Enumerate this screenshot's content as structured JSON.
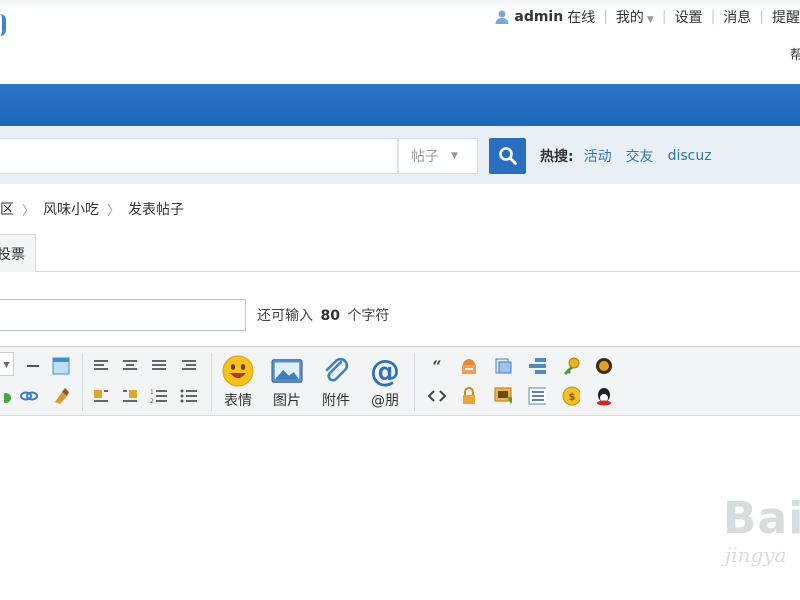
{
  "header": {
    "username": "admin",
    "online_status": "在线",
    "links": [
      "我的",
      "设置",
      "消息",
      "提醒"
    ],
    "right_fragment": "帮"
  },
  "search": {
    "scope": "帖子",
    "hot_label": "热搜:",
    "hot_links": [
      "活动",
      "交友",
      "discuz"
    ]
  },
  "breadcrumb": [
    "区",
    "风味小吃",
    "发表帖子"
  ],
  "tabs": {
    "active_label": "投票"
  },
  "subject": {
    "remaining_prefix": "还可输入",
    "remaining_count": "80",
    "remaining_suffix": "个字符"
  },
  "editor": {
    "buttons": [
      {
        "label": "表情",
        "icon": "smiley-icon"
      },
      {
        "label": "图片",
        "icon": "image-icon"
      },
      {
        "label": "附件",
        "icon": "paperclip-icon"
      },
      {
        "label": "@朋",
        "icon": "at-icon"
      }
    ]
  },
  "watermark": {
    "line1": "Bai",
    "line2": "jingya"
  },
  "colors": {
    "nav_blue": "#2270c2",
    "search_bg": "#e8eff5",
    "link_blue": "#3276b8",
    "toolbar_bg": "#f2f4f6"
  }
}
